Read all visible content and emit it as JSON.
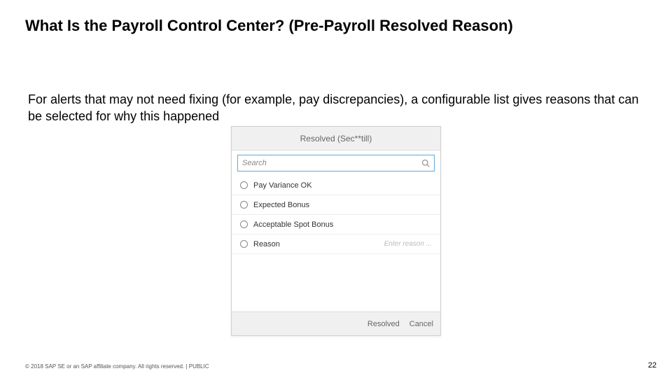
{
  "title": "What Is the Payroll Control Center? (Pre-Payroll Resolved Reason)",
  "body": "For alerts that may not need fixing (for example, pay discrepancies), a configurable list gives reasons that can be selected for why this happened",
  "panel": {
    "header": "Resolved (Sec**till)",
    "search_placeholder": "Search",
    "options": [
      {
        "label": "Pay Variance OK"
      },
      {
        "label": "Expected Bonus"
      },
      {
        "label": "Acceptable Spot Bonus"
      },
      {
        "label": "Reason"
      }
    ],
    "reason_input_placeholder": "Enter reason ...",
    "footer": {
      "primary": "Resolved",
      "secondary": "Cancel"
    }
  },
  "footer": {
    "copyright": "© 2018 SAP SE or an SAP affiliate company. All rights reserved.  |  PUBLIC",
    "page": "22"
  }
}
